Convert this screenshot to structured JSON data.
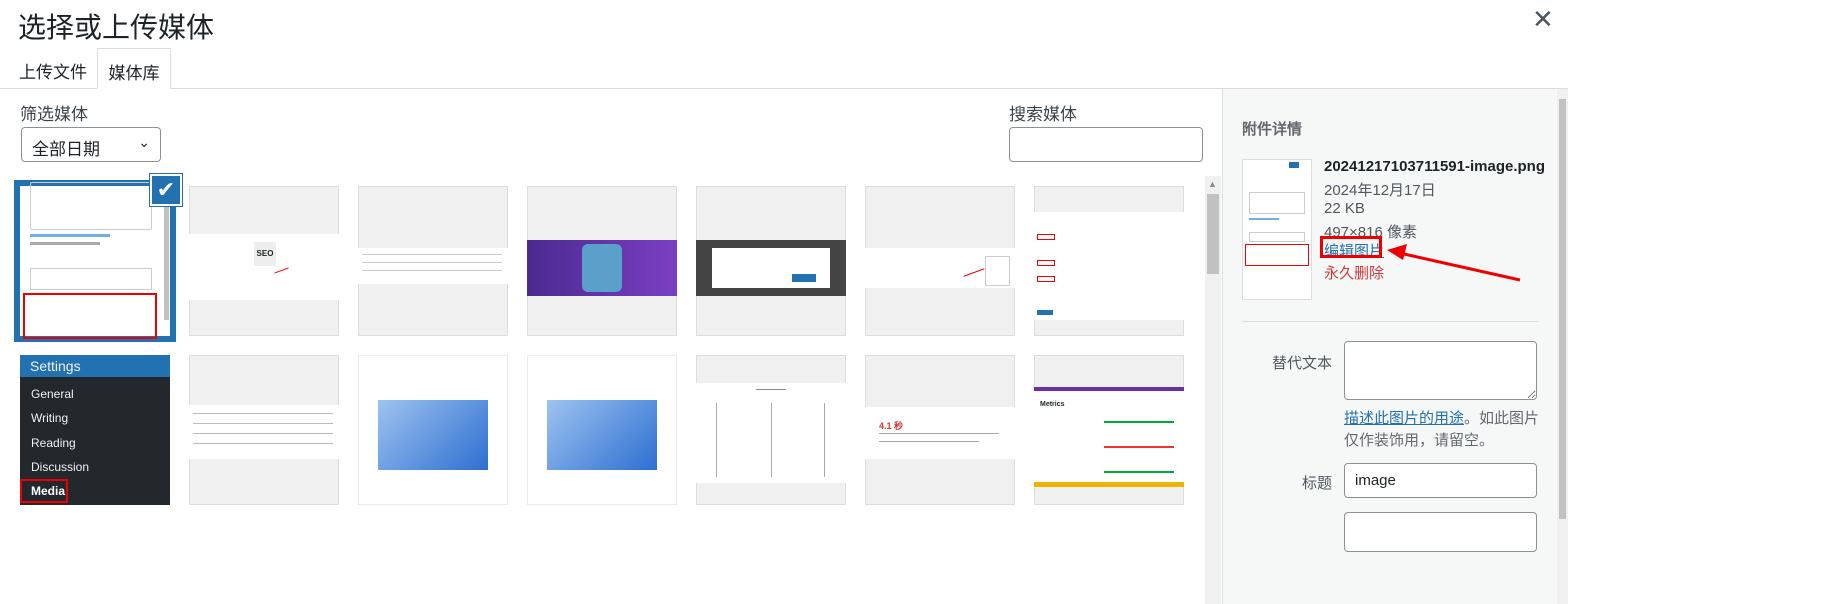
{
  "modal": {
    "title": "选择或上传媒体",
    "close_icon": "close-icon"
  },
  "tabs": [
    {
      "label": "上传文件"
    },
    {
      "label": "媒体库",
      "active": true
    }
  ],
  "toolbar": {
    "filter_label": "筛选媒体",
    "date_filter": "全部日期",
    "search_label": "搜索媒体",
    "search_value": ""
  },
  "grid": {
    "selected_index": 0,
    "thumb_texts": {
      "seo": "SEO",
      "settings_header": "Settings",
      "settings_items": [
        "General",
        "Writing",
        "Reading",
        "Discussion",
        "Media"
      ],
      "lcp_value": "4.1 秒",
      "metrics_title": "Metrics"
    }
  },
  "details": {
    "heading": "附件详情",
    "filename": "20241217103711591-image.png",
    "date": "2024年12月17日",
    "size": "22 KB",
    "dimensions": "497×816 像素",
    "edit_link": "编辑图片",
    "delete_link": "永久删除",
    "alt_label": "替代文本",
    "alt_value": "",
    "alt_help_link": "描述此图片的用途",
    "alt_help_text": "。如此图片仅作装饰用，请留空。",
    "title_label": "标题",
    "title_value": "image"
  },
  "colors": {
    "accent": "#2271b1",
    "danger": "#d63638",
    "highlight": "#e00000"
  }
}
